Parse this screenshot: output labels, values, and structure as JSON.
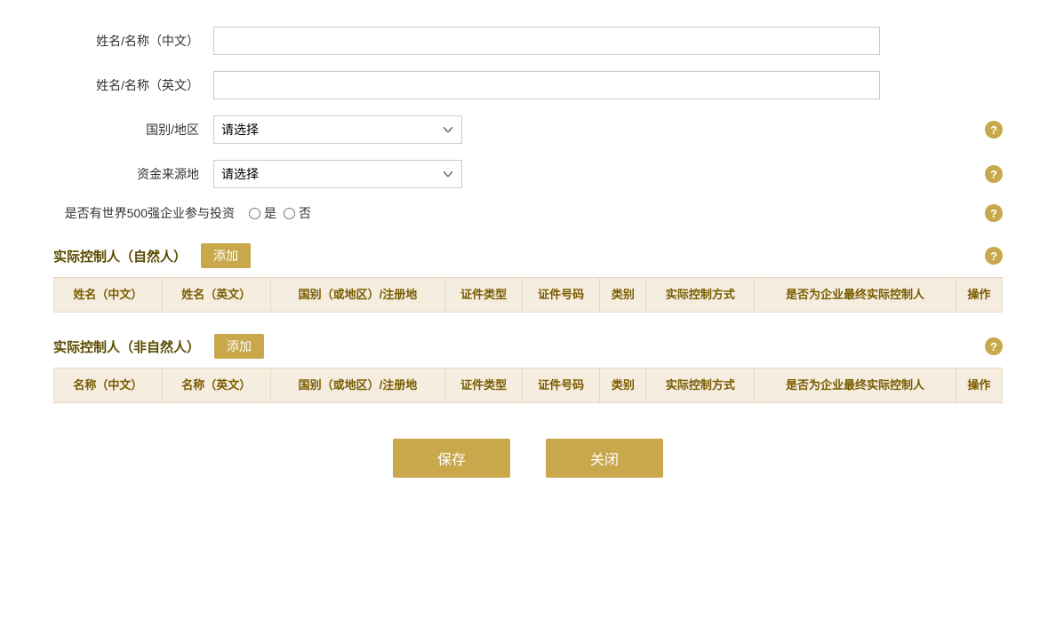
{
  "form": {
    "name_cn_label": "姓名/名称（中文）",
    "name_en_label": "姓名/名称（英文）",
    "country_label": "国别/地区",
    "fund_source_label": "资金来源地",
    "fortune500_label": "是否有世界500强企业参与投资",
    "fortune500_yes": "是",
    "fortune500_no": "否",
    "placeholder_select": "请选择"
  },
  "section1": {
    "title": "实际控制人（自然人）",
    "add_label": "添加",
    "columns": [
      "姓名（中文）",
      "姓名（英文）",
      "国别（或地区）/注册地",
      "证件类型",
      "证件号码",
      "类别",
      "实际控制方式",
      "是否为企业最终实际控制人",
      "操作"
    ]
  },
  "section2": {
    "title": "实际控制人（非自然人）",
    "add_label": "添加",
    "columns": [
      "名称（中文）",
      "名称（英文）",
      "国别（或地区）/注册地",
      "证件类型",
      "证件号码",
      "类别",
      "实际控制方式",
      "是否为企业最终实际控制人",
      "操作"
    ]
  },
  "buttons": {
    "save": "保存",
    "close": "关闭"
  },
  "help_icon": "?",
  "colors": {
    "gold": "#c8a84b",
    "table_header_bg": "#f5ede0",
    "table_header_text": "#7a5c00"
  }
}
